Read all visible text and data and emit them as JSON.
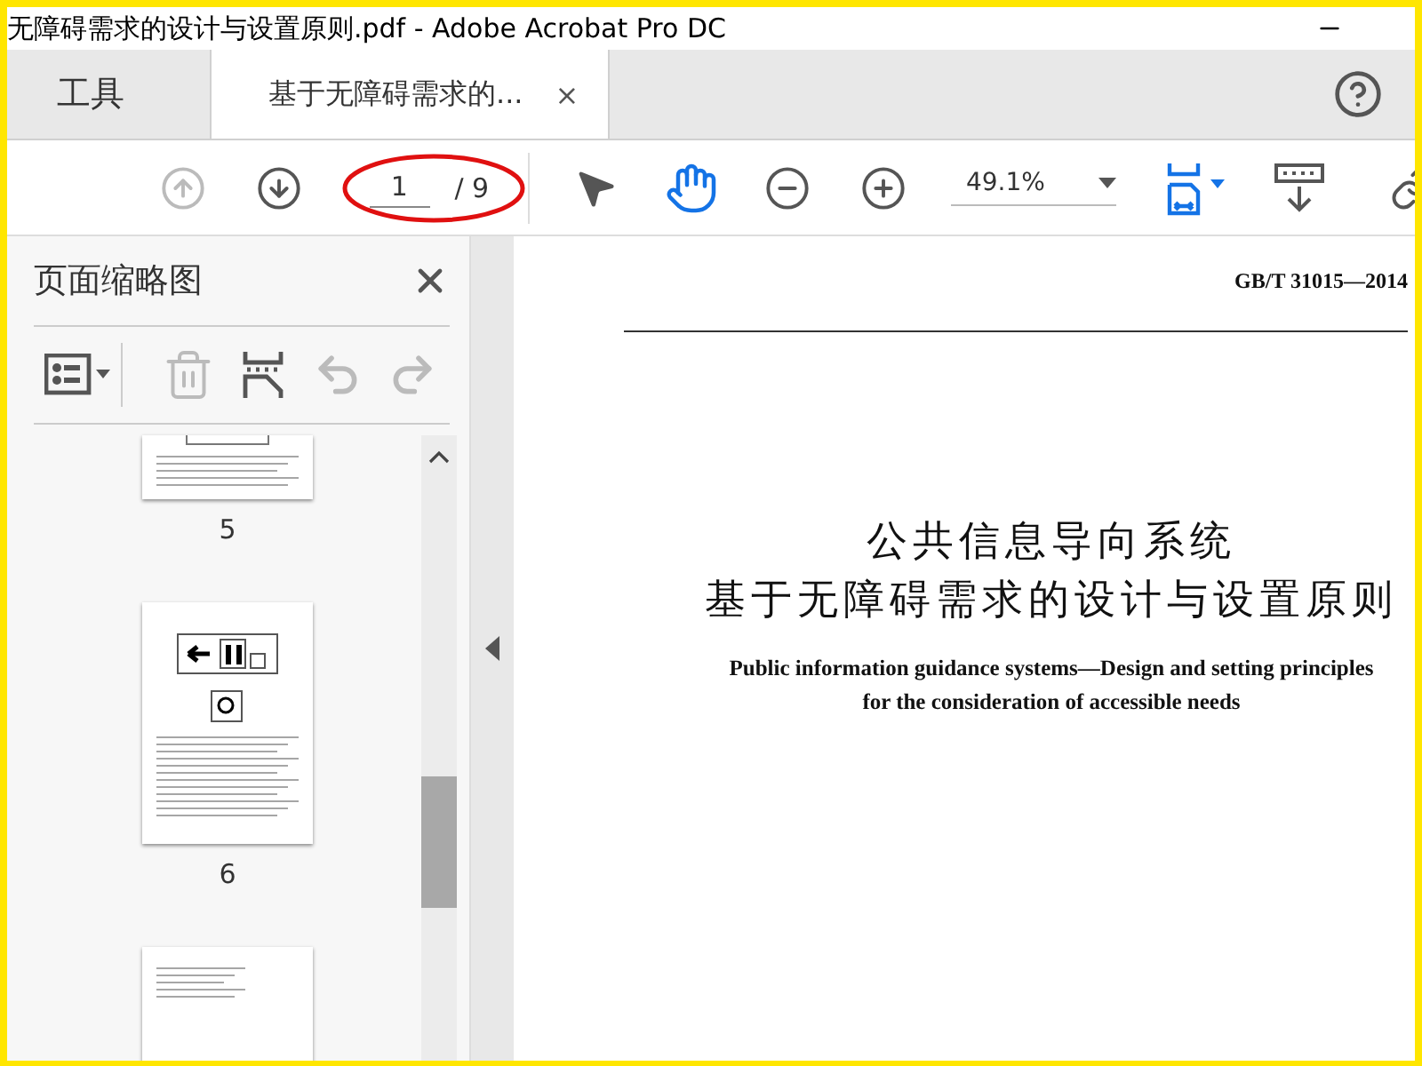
{
  "window": {
    "title": "无障碍需求的设计与设置原则.pdf - Adobe Acrobat Pro DC"
  },
  "tabs": [
    {
      "label": "工具",
      "selected": false
    },
    {
      "label": "基于无障碍需求的...",
      "selected": true,
      "close": "×"
    }
  ],
  "toolbar": [
    {
      "kind": "prev",
      "disabled": true
    },
    {
      "kind": "next",
      "disabled": false
    },
    {
      "kind": "page",
      "value": "1",
      "total": "/ 9",
      "circled": true
    },
    {
      "kind": "select",
      "selected": false
    },
    {
      "kind": "hand",
      "selected": true
    },
    {
      "kind": "zoom-out",
      "disabled": false
    },
    {
      "kind": "zoom-in",
      "disabled": false
    },
    {
      "kind": "zoom",
      "value": "49.1%"
    },
    {
      "kind": "fit",
      "disabled": false
    },
    {
      "kind": "scroll",
      "disabled": false
    },
    {
      "kind": "link",
      "disabled": false
    }
  ],
  "sidebar": {
    "title": "页面缩略图",
    "tools": [
      {
        "kind": "options",
        "disabled": false
      },
      {
        "kind": "delete",
        "disabled": true
      },
      {
        "kind": "insert",
        "disabled": false
      },
      {
        "kind": "rotate-left",
        "disabled": true
      },
      {
        "kind": "rotate-right",
        "disabled": true
      }
    ],
    "thumbnails": [
      {
        "kind": "text",
        "label": "5"
      },
      {
        "kind": "signs",
        "label": "6"
      },
      {
        "kind": "text-short"
      }
    ]
  },
  "document": {
    "code": "GB/T 31015—2014",
    "title_lines": [
      "公共信息导向系统",
      "基于无障碍需求的设计与设置原则"
    ],
    "subtitle_lines": [
      "Public information guidance systems—Design and setting principles",
      "for the consideration of accessible needs"
    ]
  }
}
